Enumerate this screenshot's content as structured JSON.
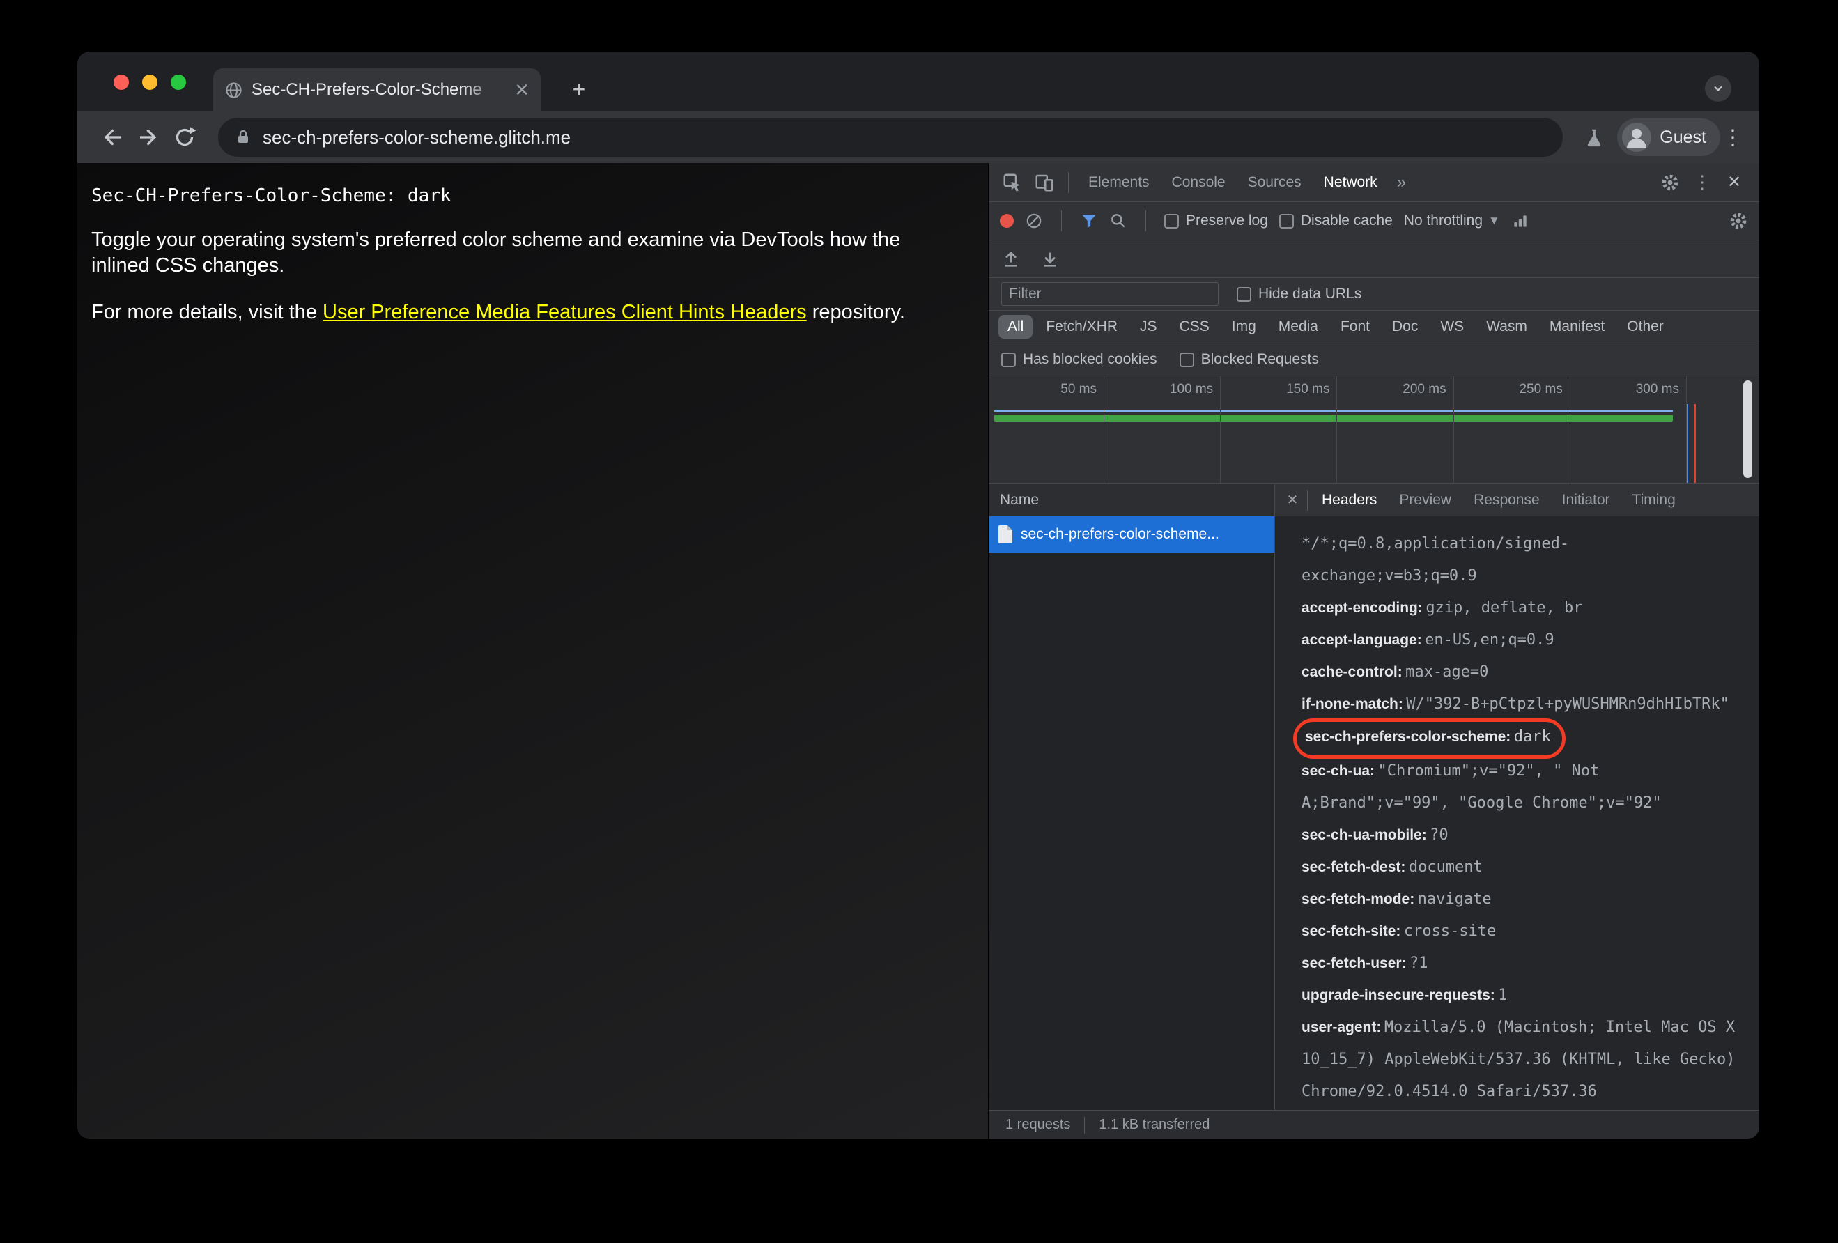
{
  "browser": {
    "tab_title": "Sec-CH-Prefers-Color-Scheme",
    "url": "sec-ch-prefers-color-scheme.glitch.me",
    "profile_label": "Guest"
  },
  "page": {
    "heading": "Sec-CH-Prefers-Color-Scheme: dark",
    "intro": "Toggle your operating system's preferred color scheme and examine via DevTools how the inlined CSS changes.",
    "more_prefix": "For more details, visit the ",
    "link_text": "User Preference Media Features Client Hints Headers",
    "more_suffix": " repository.",
    "link_color": "#ffff00"
  },
  "devtools": {
    "main_tabs": [
      "Elements",
      "Console",
      "Sources",
      "Network"
    ],
    "selected_main_tab": "Network",
    "network_toolbar": {
      "preserve_log_label": "Preserve log",
      "disable_cache_label": "Disable cache",
      "throttling_value": "No throttling"
    },
    "filter_row": {
      "filter_placeholder": "Filter",
      "hide_data_urls_label": "Hide data URLs"
    },
    "type_filters": [
      "All",
      "Fetch/XHR",
      "JS",
      "CSS",
      "Img",
      "Media",
      "Font",
      "Doc",
      "WS",
      "Wasm",
      "Manifest",
      "Other"
    ],
    "selected_type_filter": "All",
    "blocked_filters": [
      "Has blocked cookies",
      "Blocked Requests"
    ],
    "timeline_labels": [
      "50 ms",
      "100 ms",
      "150 ms",
      "200 ms",
      "250 ms",
      "300 ms"
    ],
    "requests_table": {
      "name_header": "Name",
      "rows": [
        {
          "name": "sec-ch-prefers-color-scheme...",
          "selected": true
        }
      ]
    },
    "detail_tabs": [
      "Headers",
      "Preview",
      "Response",
      "Initiator",
      "Timing"
    ],
    "selected_detail_tab": "Headers",
    "request_headers": [
      {
        "name": "",
        "value": "*/*;q=0.8,application/signed-exchange;v=b3;q=0.9"
      },
      {
        "name": "accept-encoding:",
        "value": "gzip, deflate, br"
      },
      {
        "name": "accept-language:",
        "value": "en-US,en;q=0.9"
      },
      {
        "name": "cache-control:",
        "value": "max-age=0"
      },
      {
        "name": "if-none-match:",
        "value": "W/\"392-B+pCtpzl+pyWUSHMRn9dhHIbTRk\""
      },
      {
        "name": "sec-ch-prefers-color-scheme:",
        "value": "dark",
        "highlighted": true
      },
      {
        "name": "sec-ch-ua:",
        "value": "\"Chromium\";v=\"92\", \" Not A;Brand\";v=\"99\", \"Google Chrome\";v=\"92\""
      },
      {
        "name": "sec-ch-ua-mobile:",
        "value": "?0"
      },
      {
        "name": "sec-fetch-dest:",
        "value": "document"
      },
      {
        "name": "sec-fetch-mode:",
        "value": "navigate"
      },
      {
        "name": "sec-fetch-site:",
        "value": "cross-site"
      },
      {
        "name": "sec-fetch-user:",
        "value": "?1"
      },
      {
        "name": "upgrade-insecure-requests:",
        "value": "1"
      },
      {
        "name": "user-agent:",
        "value": "Mozilla/5.0 (Macintosh; Intel Mac OS X 10_15_7) AppleWebKit/537.36 (KHTML, like Gecko) Chrome/92.0.4514.0 Safari/537.36"
      }
    ],
    "highlight_color": "#f23b25",
    "selection_color": "#1d6fd6",
    "status_bar": {
      "requests_count": "1 requests",
      "transferred": "1.1 kB transferred"
    }
  }
}
